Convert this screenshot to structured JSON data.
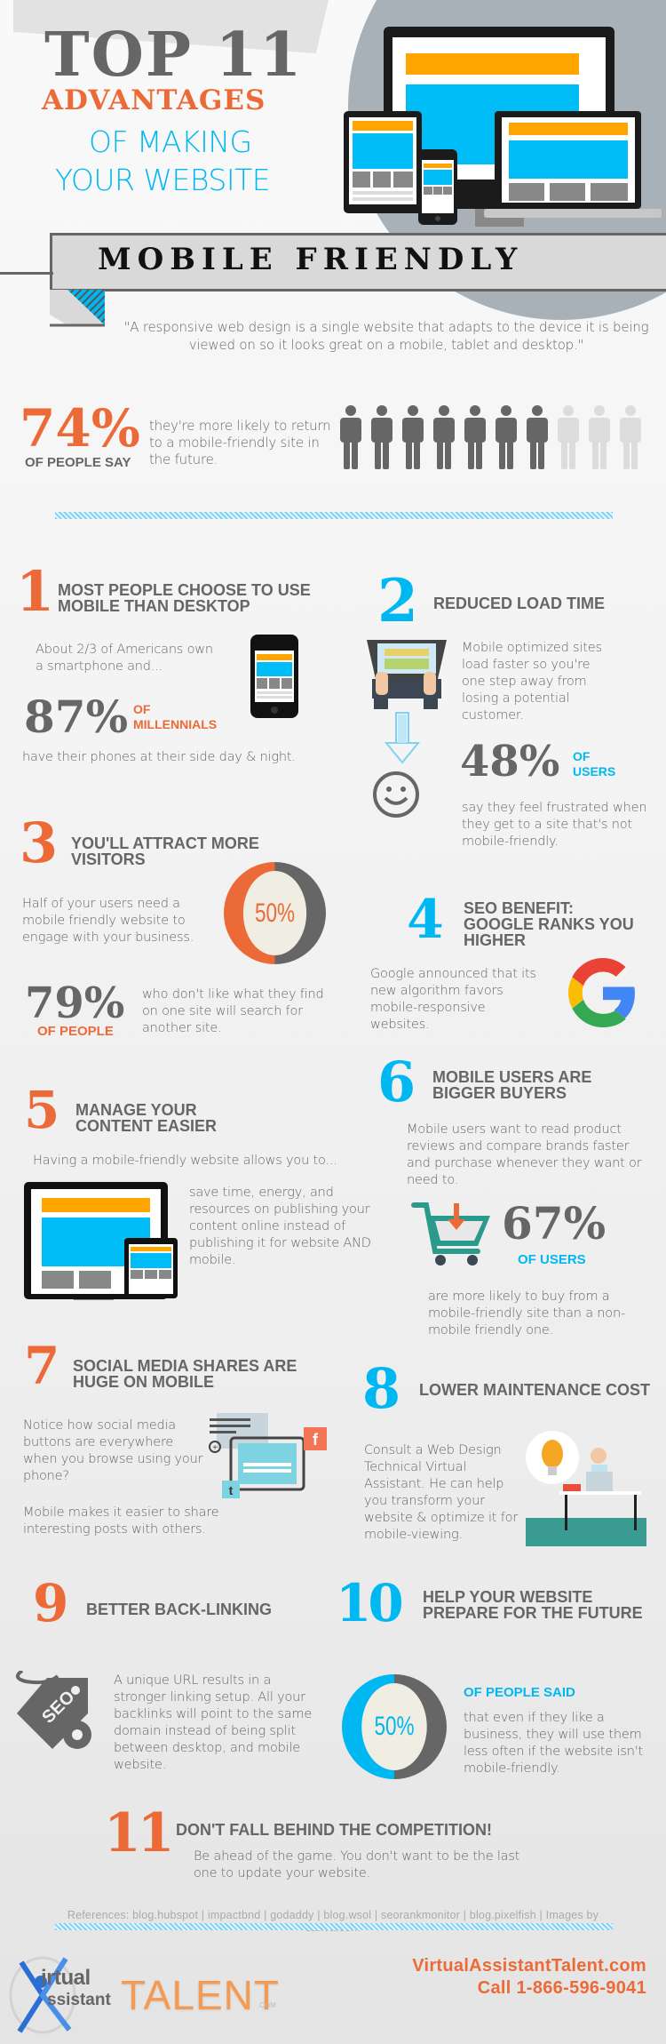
{
  "header": {
    "title_line1": "TOP 11",
    "title_line2": "ADVANTAGES",
    "title_line3": "OF MAKING",
    "title_line4": "YOUR WEBSITE",
    "banner": "MOBILE FRIENDLY"
  },
  "quote": "\"A responsive web design is a single website that adapts to the device it is being viewed on so it looks great on a mobile, tablet and desktop.\"",
  "stat_people": {
    "value": "74%",
    "label": "OF PEOPLE SAY",
    "text": "they're more likely to return to a mobile-friendly site in the future.",
    "filled": 7,
    "total": 10
  },
  "colors": {
    "orange": "#ec6a37",
    "blue": "#00b8f1",
    "gray": "#666666",
    "light_gray": "#dcdcdc",
    "device_orange": "#ffa500",
    "device_blue": "#00bdf7"
  },
  "advantages": [
    {
      "number": "1",
      "title": "MOST PEOPLE CHOOSE TO USE MOBILE THAN DESKTOP",
      "intro": "About 2/3 of Americans own a smartphone and...",
      "stat": "87%",
      "stat_label_1": "OF",
      "stat_label_2": "MILLENNIALS",
      "outro": "have their phones at their side day & night.",
      "icon": "smartphone-icon"
    },
    {
      "number": "2",
      "title": "REDUCED LOAD TIME",
      "intro": "Mobile optimized sites load faster so you're one step away from losing a potential customer.",
      "stat": "48%",
      "stat_label_1": "OF",
      "stat_label_2": "USERS",
      "outro": "say they feel frustrated when they get to a site that's not mobile-friendly.",
      "icon": "laptop-typing-icon"
    },
    {
      "number": "3",
      "title": "YOU'LL ATTRACT MORE VISITORS",
      "intro": "Half of your users need a mobile friendly website to engage with your business.",
      "ring_value": "50%",
      "ring_fraction": 0.5,
      "stat": "79%",
      "stat_label_1": "OF PEOPLE",
      "outro": "who don't like what they find on one site will search for another site."
    },
    {
      "number": "4",
      "title": "SEO BENEFIT: GOOGLE RANKS YOU HIGHER",
      "intro": "Google announced that its new algorithm favors mobile-responsive websites.",
      "icon": "google-logo-icon"
    },
    {
      "number": "5",
      "title": "MANAGE YOUR CONTENT EASIER",
      "intro": "Having a mobile-friendly website allows you to...",
      "outro": "save time, energy, and resources on publishing your content online instead of publishing it for website AND mobile.",
      "icon": "desktop-tablet-icon"
    },
    {
      "number": "6",
      "title": "MOBILE USERS ARE BIGGER BUYERS",
      "intro": "Mobile users want to read product reviews and compare brands faster and purchase whenever they want or need to.",
      "stat": "67%",
      "stat_label_1": "OF USERS",
      "outro": "are more likely to buy from a mobile-friendly site than a non-mobile friendly one.",
      "icon": "shopping-cart-icon"
    },
    {
      "number": "7",
      "title": "SOCIAL MEDIA SHARES ARE HUGE ON MOBILE",
      "intro": "Notice how social media buttons are everywhere when you browse using your phone?",
      "outro": "Mobile makes it easier to share interesting posts with others.",
      "icon": "social-tablet-icon"
    },
    {
      "number": "8",
      "title": "LOWER MAINTENANCE COST",
      "intro": "Consult a Web Design Technical Virtual Assistant. He can help you transform your website & optimize it for mobile-viewing.",
      "icon": "worker-desk-icon"
    },
    {
      "number": "9",
      "title": "BETTER BACK-LINKING",
      "intro": "A unique URL results in a stronger linking setup. All your backlinks will point to the same domain instead of being split between desktop, and mobile website.",
      "icon": "seo-tag-icon",
      "icon_text": "SEO"
    },
    {
      "number": "10",
      "title": "HELP YOUR WEBSITE PREPARE FOR THE FUTURE",
      "ring_value": "50%",
      "ring_fraction": 0.5,
      "stat_label_1": "OF PEOPLE SAID",
      "outro": "that even if they like a business, they will use them less often if the website isn't mobile-friendly."
    },
    {
      "number": "11",
      "title": "DON'T FALL BEHIND THE COMPETITION!",
      "intro": "Be ahead of the game. You don't want to be the last one to update your website."
    }
  ],
  "footer": {
    "references": "References: blog.hubspot | impactbnd | godaddy | blog.wsol | seorankmonitor | blog.pixelfish | Images by canva.com",
    "logo_line1": "irtual",
    "logo_line2": "ssistant",
    "logo_talent": "TALENT",
    "logo_com": ".COM",
    "website": "VirtualAssistantTalent.com",
    "phone": "Call 1-866-596-9041"
  }
}
